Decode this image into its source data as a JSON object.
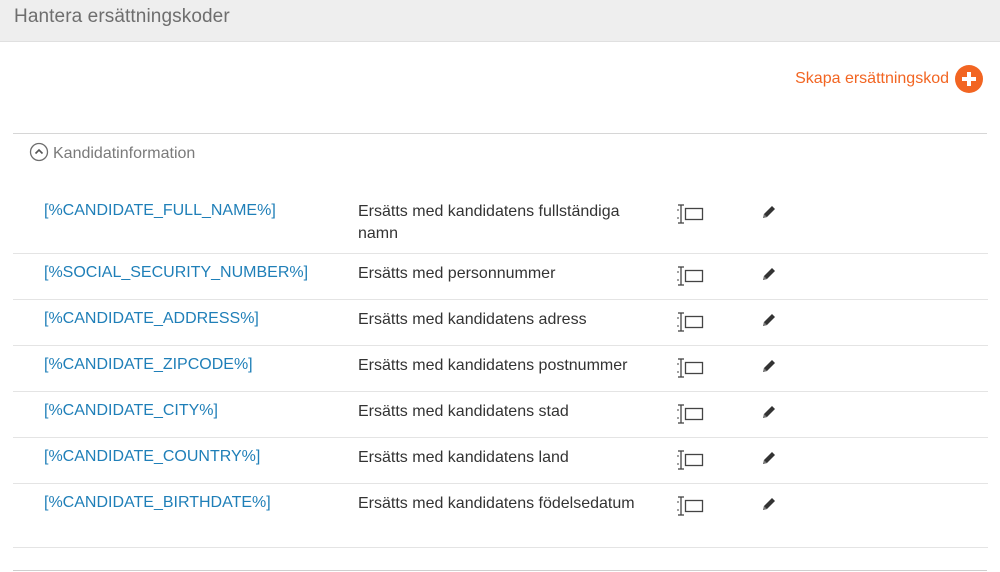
{
  "header": {
    "title": "Hantera ersättningskoder"
  },
  "actions": {
    "create_label": "Skapa ersättningskod",
    "create_icon": "plus-circle-icon",
    "accent_color": "#f26522"
  },
  "section": {
    "label": "Kandidatinformation",
    "toggle_icon": "chevron-up-circle-icon"
  },
  "rows": [
    {
      "code": "[%CANDIDATE_FULL_NAME%]",
      "description": "Ersätts med kandidatens fullständiga namn"
    },
    {
      "code": "[%SOCIAL_SECURITY_NUMBER%]",
      "description": "Ersätts med personnummer"
    },
    {
      "code": "[%CANDIDATE_ADDRESS%]",
      "description": "Ersätts med kandidatens adress"
    },
    {
      "code": "[%CANDIDATE_ZIPCODE%]",
      "description": "Ersätts med kandidatens postnummer"
    },
    {
      "code": "[%CANDIDATE_CITY%]",
      "description": "Ersätts med kandidatens stad"
    },
    {
      "code": "[%CANDIDATE_COUNTRY%]",
      "description": "Ersätts med kandidatens land"
    },
    {
      "code": "[%CANDIDATE_BIRTHDATE%]",
      "description": "Ersätts med kandidatens födelsedatum"
    }
  ],
  "row_icons": {
    "copy": "copy-text-icon",
    "edit": "pencil-icon"
  },
  "colors": {
    "link": "#1f7fb8",
    "header_bg": "#eeeeee"
  }
}
